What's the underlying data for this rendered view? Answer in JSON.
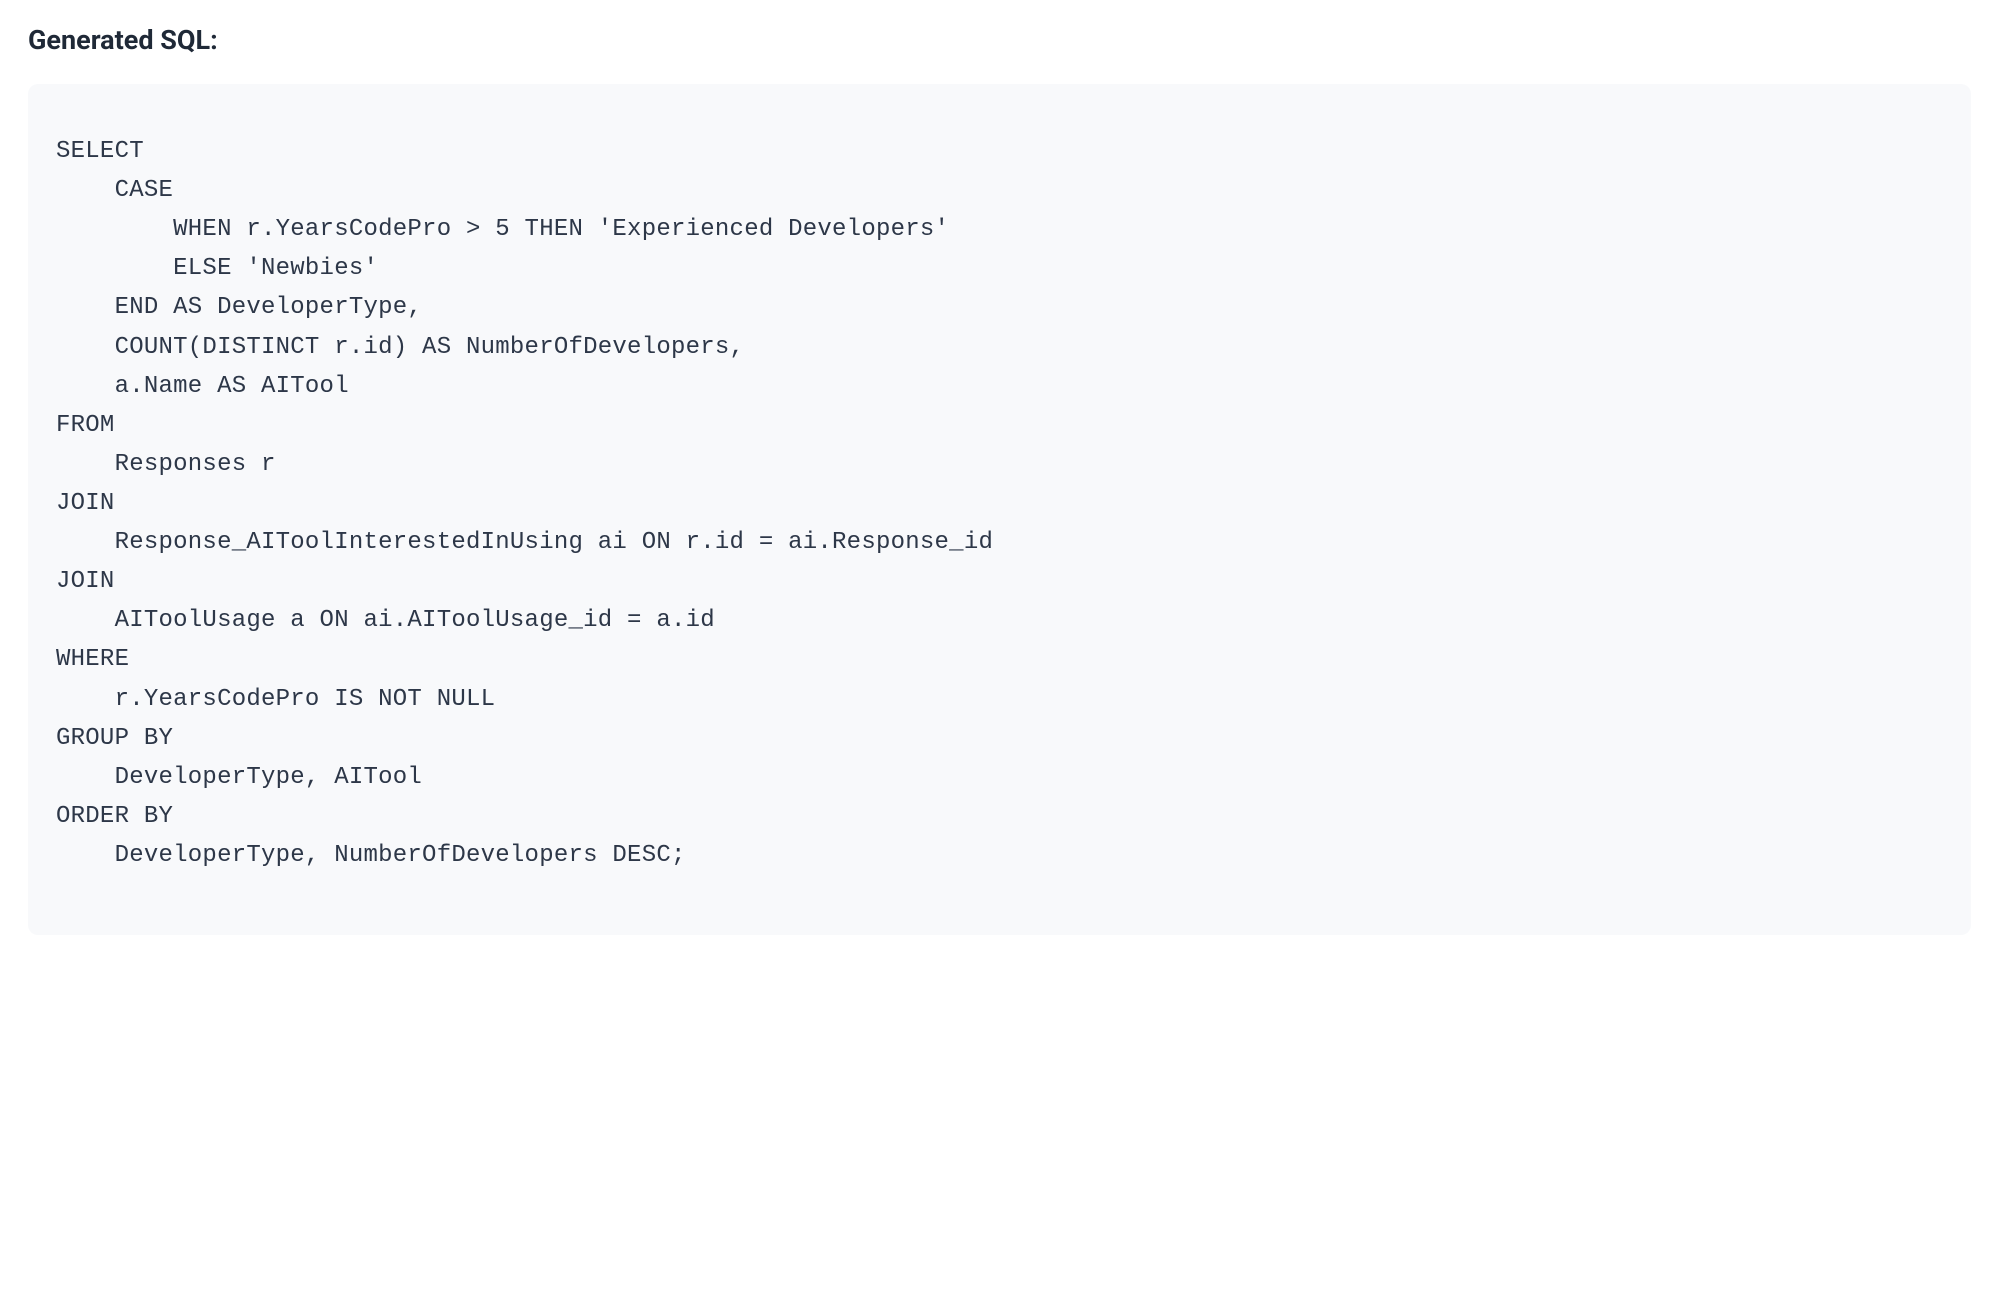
{
  "heading": "Generated SQL:",
  "sql": "SELECT\n    CASE\n        WHEN r.YearsCodePro > 5 THEN 'Experienced Developers'\n        ELSE 'Newbies'\n    END AS DeveloperType,\n    COUNT(DISTINCT r.id) AS NumberOfDevelopers,\n    a.Name AS AITool\nFROM\n    Responses r\nJOIN\n    Response_AIToolInterestedInUsing ai ON r.id = ai.Response_id\nJOIN\n    AIToolUsage a ON ai.AIToolUsage_id = a.id\nWHERE\n    r.YearsCodePro IS NOT NULL\nGROUP BY\n    DeveloperType, AITool\nORDER BY\n    DeveloperType, NumberOfDevelopers DESC;"
}
